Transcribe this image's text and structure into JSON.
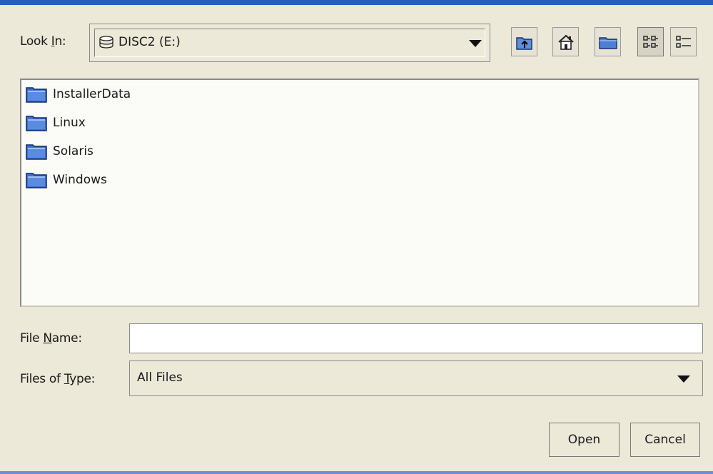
{
  "look_in": {
    "label_prefix": "Look ",
    "label_mnemonic": "I",
    "label_suffix": "n:",
    "value": "DISC2 (E:)",
    "icon": "drive-icon"
  },
  "toolbar": {
    "buttons": [
      {
        "name": "up-one-level-button",
        "icon": "up-folder-icon"
      },
      {
        "name": "home-button",
        "icon": "home-icon"
      },
      {
        "name": "new-folder-button",
        "icon": "new-folder-icon"
      },
      {
        "name": "list-view-button",
        "icon": "list-view-icon",
        "pressed": true
      },
      {
        "name": "details-view-button",
        "icon": "details-view-icon"
      }
    ]
  },
  "files": [
    {
      "label": "InstallerData",
      "icon": "folder-icon"
    },
    {
      "label": "Linux",
      "icon": "folder-icon"
    },
    {
      "label": "Solaris",
      "icon": "folder-icon"
    },
    {
      "label": "Windows",
      "icon": "folder-icon"
    }
  ],
  "file_name": {
    "label_prefix": "File ",
    "label_mnemonic": "N",
    "label_suffix": "ame:",
    "value": ""
  },
  "file_type": {
    "label_prefix": "Files of ",
    "label_mnemonic": "T",
    "label_suffix": "ype:",
    "value": "All Files"
  },
  "actions": {
    "open_label": "Open",
    "cancel_label": "Cancel"
  },
  "colors": {
    "title_bar": "#2a5cc9",
    "dialog_bg": "#ece9d8",
    "list_bg": "#fbfbf8",
    "folder_blue": "#3f6fcf"
  }
}
